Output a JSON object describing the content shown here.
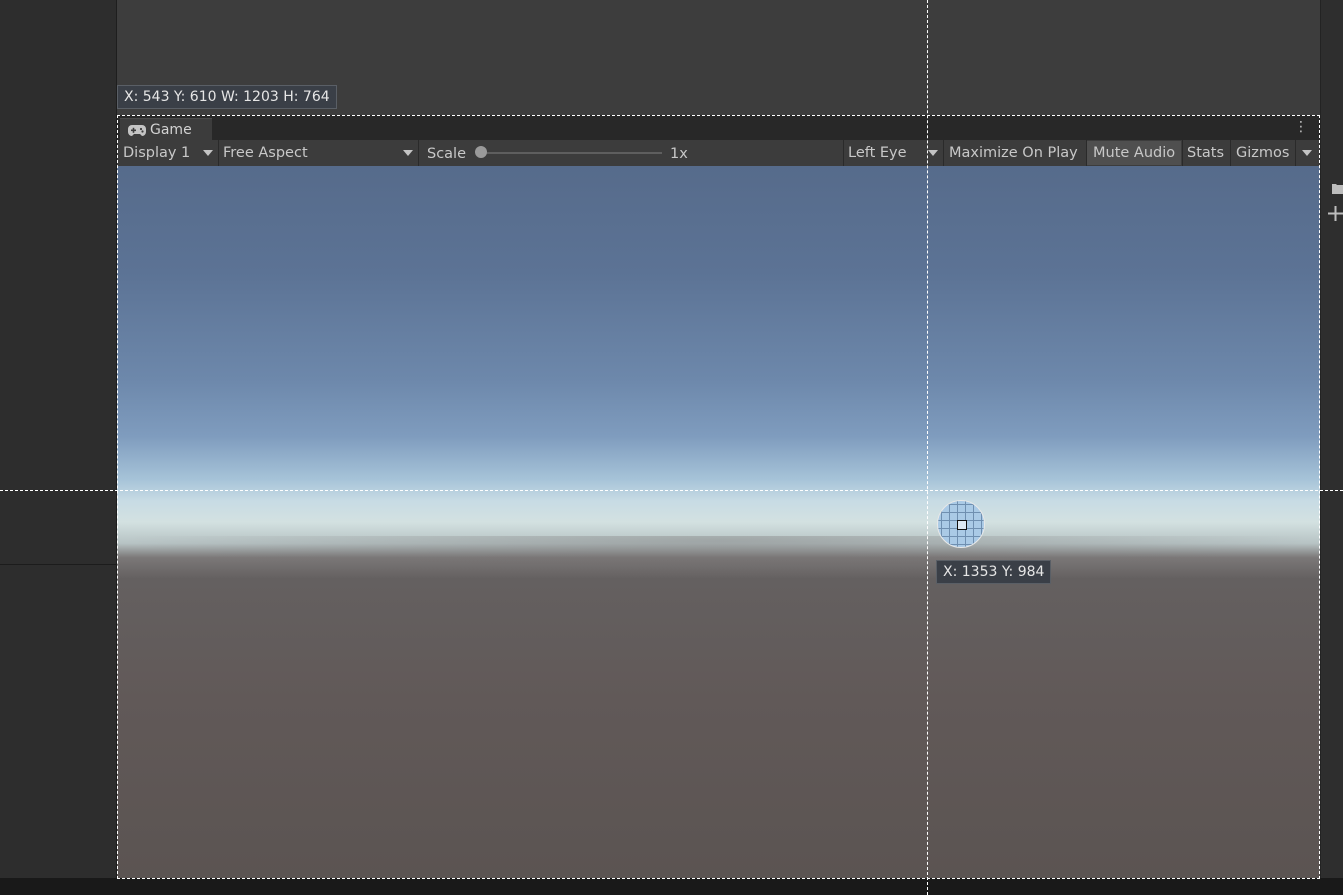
{
  "selection": {
    "rect_readout": "X: 543 Y: 610 W: 1203 H: 764",
    "point_readout": "X: 1353 Y: 984"
  },
  "game_view": {
    "tab_label": "Game",
    "tab_icon": "gamepad-icon",
    "menu_icon": "kebab-menu-icon",
    "toolbar": {
      "display": "Display 1",
      "aspect": "Free Aspect",
      "scale_label": "Scale",
      "scale_value": "1x",
      "eye": "Left Eye",
      "maximize_on_play": "Maximize On Play",
      "mute_audio": "Mute Audio",
      "stats": "Stats",
      "gizmos": "Gizmos"
    }
  },
  "colors": {
    "sky_top": "#566b8b",
    "horizon": "#d3e1e1",
    "ground": "#5e5654",
    "toolbar": "#3c3c3c",
    "mute_active": "#4f4f4f"
  }
}
